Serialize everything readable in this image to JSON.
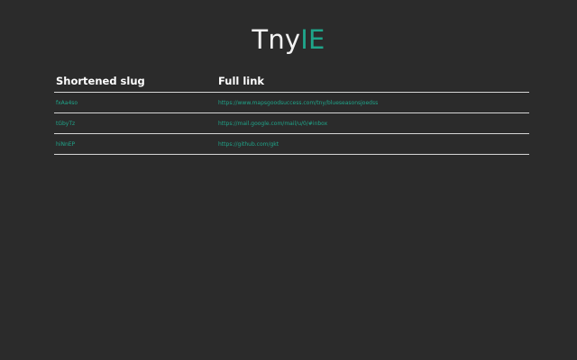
{
  "app": {
    "logo_part_a": "Tny",
    "logo_part_b": "IE"
  },
  "colors": {
    "background": "#2b2b2b",
    "accent": "#1fa58a",
    "text": "#ffffff",
    "divider": "#d6d6d6"
  },
  "table": {
    "headers": [
      "Shortened slug",
      "Full link"
    ],
    "rows": [
      {
        "slug": "fxAa4so",
        "url": "https://www.mapsgoodsuccess.com/tny/blueseasonsjoedss"
      },
      {
        "slug": "tGbyTz",
        "url": "https://mail.google.com/mail/u/0/#inbox"
      },
      {
        "slug": "hiNnEP",
        "url": "https://github.com/gkt"
      }
    ]
  }
}
